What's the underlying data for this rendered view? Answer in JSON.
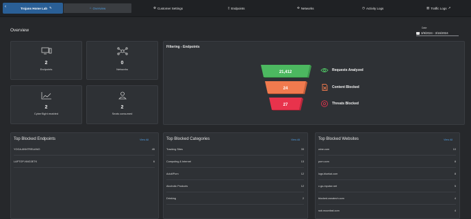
{
  "nav": {
    "site_label": "Trojans Home Lab",
    "overview": "Overview",
    "customer_settings": "Customer Settings",
    "endpoints": "Endpoints",
    "networks": "Networks",
    "activity_logs": "Activity Logs",
    "traffic_logs": "Traffic Logs"
  },
  "page": {
    "title": "Overview",
    "date_label": "Date",
    "date_range": "3/9/2024 - 3/16/2024"
  },
  "stats": {
    "endpoints": {
      "value": "2",
      "label": "Endpoints"
    },
    "networks": {
      "value": "0",
      "label": "Networks"
    },
    "cybersight": {
      "value": "2",
      "label": "CyberSight enabled"
    },
    "seats": {
      "value": "2",
      "label": "Seats consumed"
    }
  },
  "funnel": {
    "title": "Filtering - Endpoints",
    "levels": [
      {
        "value": "21,412",
        "label": "Requests Analyzed",
        "color": "#4cb860"
      },
      {
        "value": "24",
        "label": "Content Blocked",
        "color": "#f07a4e"
      },
      {
        "value": "27",
        "label": "Threats Blocked",
        "color": "#e8334c"
      }
    ]
  },
  "blocked_endpoints": {
    "title": "Top Blocked Endpoints",
    "view_all": "View All",
    "rows": [
      {
        "name": "YOGA-6NNTREUANO",
        "count": "45"
      },
      {
        "name": "LAPTOP-NNG3ETK",
        "count": "6"
      }
    ]
  },
  "blocked_categories": {
    "title": "Top Blocked Categories",
    "view_all": "View All",
    "rows": [
      {
        "name": "Tracking Sites",
        "count": "33"
      },
      {
        "name": "Computing & Internet",
        "count": "13"
      },
      {
        "name": "Adult/Porn",
        "count": "12"
      },
      {
        "name": "Alcoholic Products",
        "count": "12"
      },
      {
        "name": "Drinking",
        "count": "2"
      }
    ]
  },
  "blocked_websites": {
    "title": "Top Blocked Websites",
    "view_all": "View All",
    "rows": [
      {
        "name": "wine.com",
        "count": "10"
      },
      {
        "name": "porn.com",
        "count": "8"
      },
      {
        "name": "logs.bluekai.com",
        "count": "8"
      },
      {
        "name": "c.go-mpulse.net",
        "count": "5"
      },
      {
        "name": "blocked.zonatech.com",
        "count": "4"
      },
      {
        "name": "ssb.moonfast.com",
        "count": "4"
      }
    ]
  }
}
